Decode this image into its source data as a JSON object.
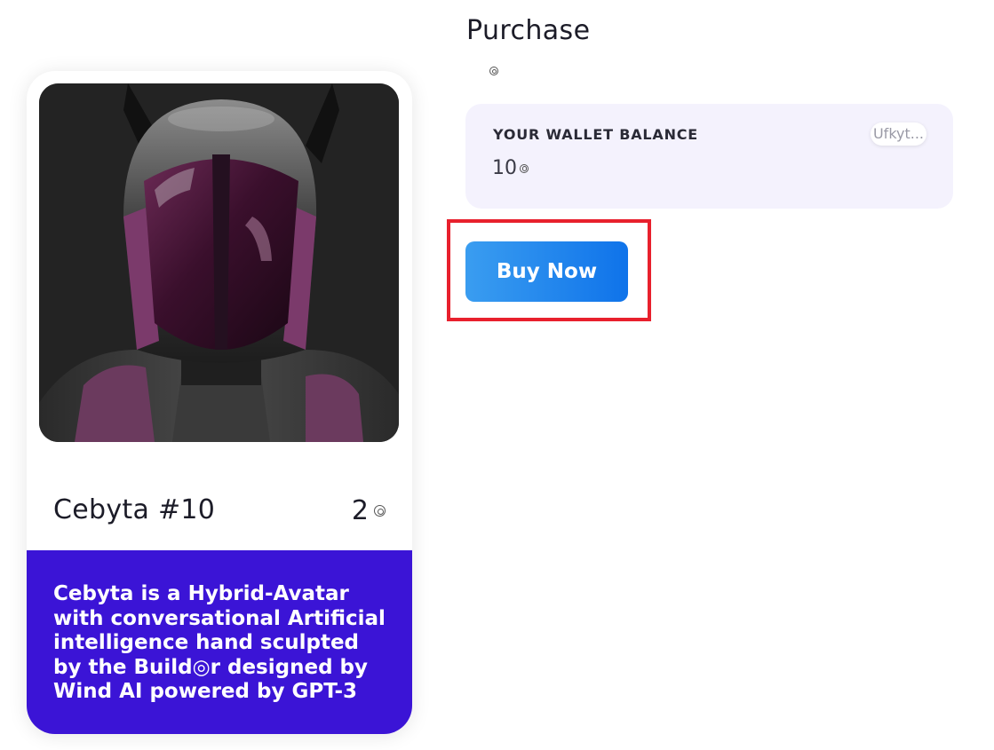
{
  "card": {
    "image_icon": "avatar-robot-helmet-image",
    "title": "Cebyta #10",
    "price": "2",
    "price_icon": "coin-icon",
    "description": "Cebyta is a Hybrid-Avatar with conversational Artificial intelligence hand sculpted by the Build◎r designed by Wind AI powered by GPT-3",
    "description_color": "#3b14d6"
  },
  "purchase": {
    "title": "Purchase",
    "currency_icon": "coin-icon"
  },
  "wallet": {
    "label": "YOUR WALLET BALANCE",
    "value": "10",
    "value_icon": "coin-icon",
    "address_chip": "Ufkyt..."
  },
  "actions": {
    "buy_label": "Buy Now",
    "highlight_color": "#e8202d"
  },
  "colors": {
    "accent": "#1a7ff0",
    "wallet_bg": "#f4f2fd"
  }
}
